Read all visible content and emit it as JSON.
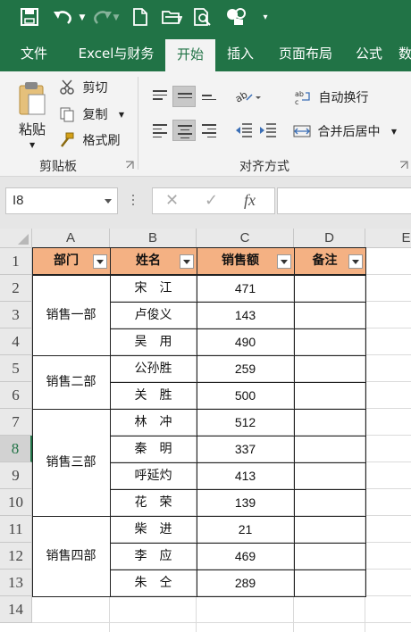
{
  "qat": {
    "icons": [
      "save-icon",
      "undo-icon",
      "redo-icon",
      "new-file-icon",
      "open-folder-icon",
      "print-preview-icon",
      "touch-mode-icon",
      "customize-qat-icon"
    ]
  },
  "tabs": [
    "文件",
    "Excel与财务",
    "开始",
    "插入",
    "页面布局",
    "公式",
    "数"
  ],
  "active_tab": "开始",
  "ribbon": {
    "clipboard": {
      "paste": "粘贴",
      "cut": "剪切",
      "copy": "复制",
      "format_painter": "格式刷",
      "group_label": "剪贴板"
    },
    "alignment": {
      "wrap_text": "自动换行",
      "merge_center": "合并后居中",
      "group_label": "对齐方式"
    }
  },
  "formula_bar": {
    "name_box": "I8",
    "fx": "fx",
    "cancel": "✕",
    "enter": "✓",
    "formula": ""
  },
  "grid": {
    "columns": [
      "A",
      "B",
      "C",
      "D",
      "E"
    ],
    "rows": [
      "1",
      "2",
      "3",
      "4",
      "5",
      "6",
      "7",
      "8",
      "9",
      "10",
      "11",
      "12",
      "13",
      "14"
    ],
    "selected_row": "8",
    "headers": [
      "部门",
      "姓名",
      "销售额",
      "备注"
    ],
    "departments": [
      "销售一部",
      "销售二部",
      "销售三部",
      "销售四部"
    ],
    "names": [
      "宋　江",
      "卢俊义",
      "吴　用",
      "公孙胜",
      "关　胜",
      "林　冲",
      "秦　明",
      "呼延灼",
      "花　荣",
      "柴　进",
      "李　应",
      "朱　仝"
    ],
    "sales": [
      "471",
      "143",
      "490",
      "259",
      "500",
      "512",
      "337",
      "413",
      "139",
      "21",
      "469",
      "289"
    ]
  },
  "colors": {
    "excel_green": "#217346",
    "header_fill": "#f4b183"
  }
}
